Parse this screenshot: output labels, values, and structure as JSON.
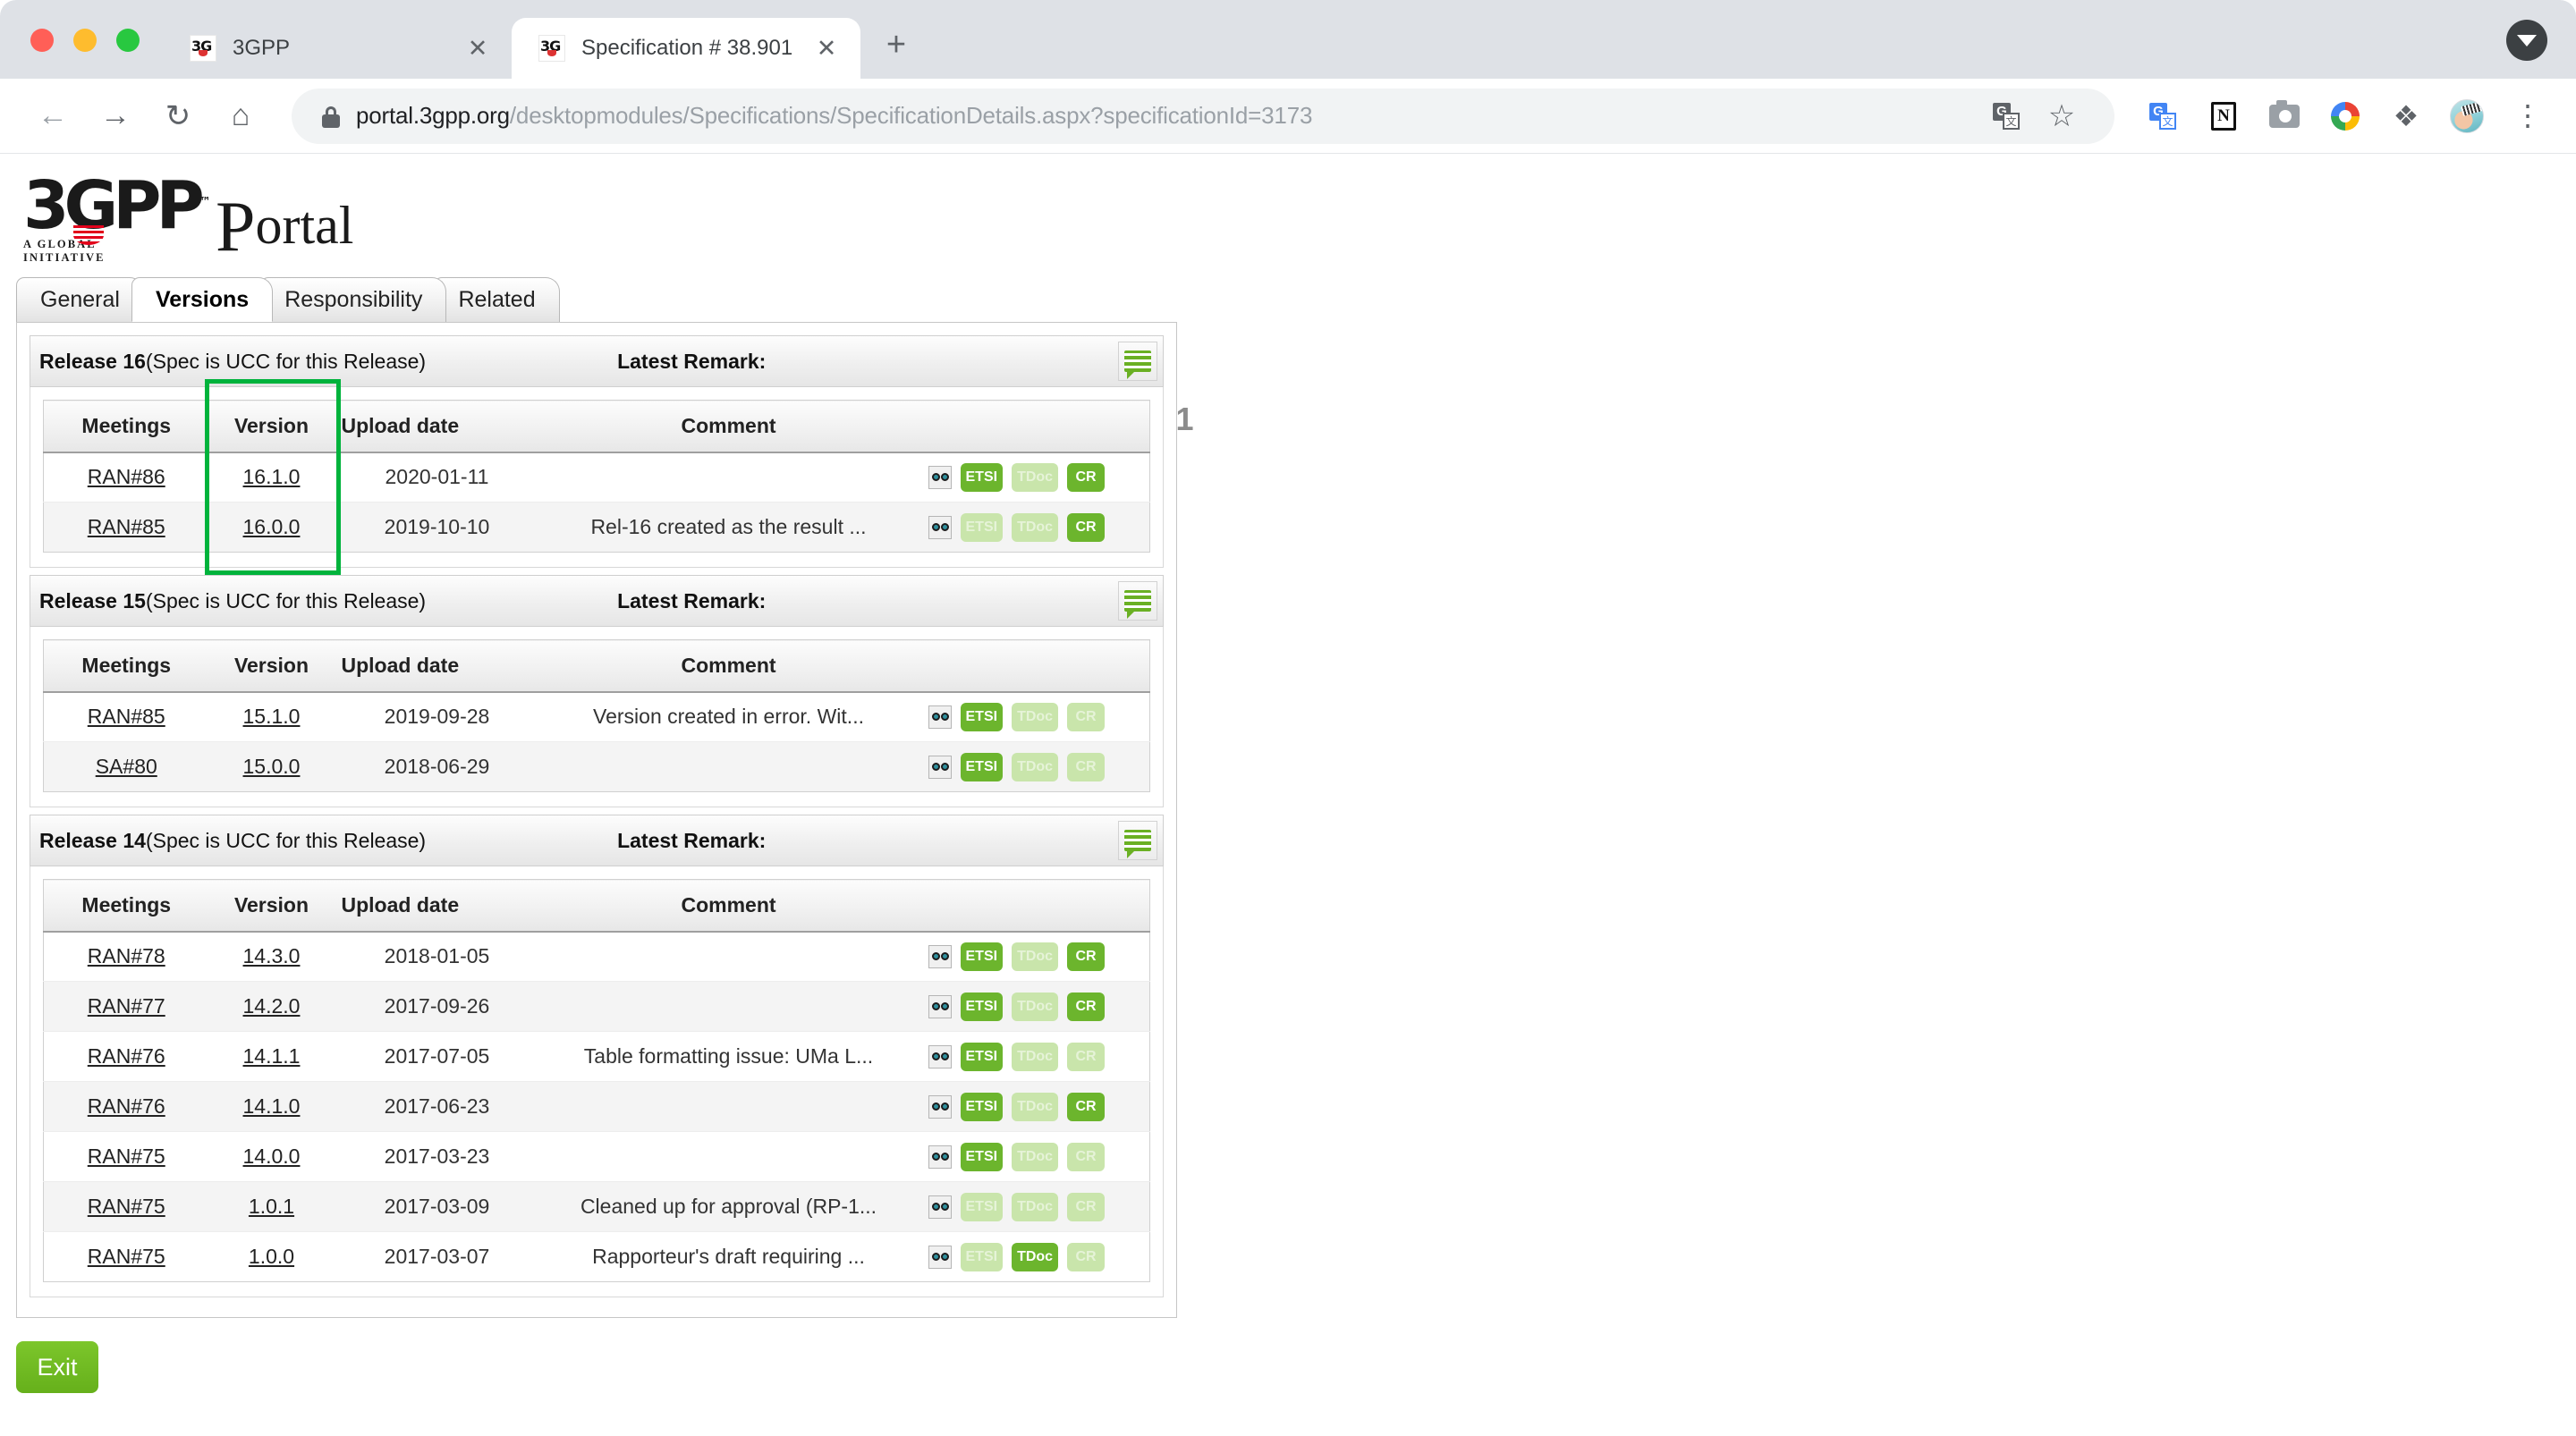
{
  "browser": {
    "tabs": [
      {
        "title": "3GPP",
        "favicon": "3gpp-favicon",
        "active": false,
        "close_label": "✕"
      },
      {
        "title": "Specification # 38.901",
        "favicon": "3gpp-favicon",
        "active": true,
        "close_label": "✕"
      }
    ],
    "new_tab_label": "+",
    "tab_search_icon": "chevron-down-icon",
    "nav": {
      "back_label": "←",
      "forward_label": "→",
      "reload_label": "↻",
      "home_label": "⌂"
    },
    "omnibox": {
      "lock_icon": "lock-icon",
      "url_host": "portal.3gpp.org",
      "url_path": "/desktopmodules/Specifications/SpecificationDetails.aspx?specificationId=3173",
      "translate_icon": "translate-icon",
      "bookmark_icon": "star-icon"
    },
    "extensions": [
      {
        "name": "google-translate-icon"
      },
      {
        "name": "notion-icon",
        "glyph": "N"
      },
      {
        "name": "screenshot-camera-icon"
      },
      {
        "name": "google-photos-icon"
      },
      {
        "name": "extensions-puzzle-icon",
        "glyph": "❖"
      },
      {
        "name": "profile-avatar-icon"
      },
      {
        "name": "chrome-menu-icon",
        "glyph": "⋮"
      }
    ]
  },
  "site": {
    "logo": {
      "mark": "3GPP",
      "tm": "™",
      "tagline": "A GLOBAL INITIATIVE",
      "portal_p": "P",
      "portal_rest": "ortal"
    },
    "tabs": [
      {
        "label": "General",
        "active": false
      },
      {
        "label": "Versions",
        "active": true
      },
      {
        "label": "Responsibility",
        "active": false
      },
      {
        "label": "Related",
        "active": false
      }
    ],
    "spec_title": "Specification #: 38.901",
    "exit_label": "Exit",
    "columns": [
      "Meetings",
      "Version",
      "Upload date",
      "Comment"
    ],
    "remark_label": "Latest Remark:",
    "note_icon": "comment-note-icon",
    "preview_icon": "document-preview-icon",
    "highlight_color": "#00b33c",
    "badge_on_color": "#6cb52d",
    "badge_off_color": "#c9e5ab",
    "releases": [
      {
        "name": "Release 16",
        "ucc_note": "(Spec is UCC for this Release)",
        "remark_value": "",
        "rows": [
          {
            "meeting": "RAN#86",
            "version": "16.1.0",
            "date": "2020-01-11",
            "comment": "",
            "badges": [
              {
                "label": "ETSI",
                "on": true
              },
              {
                "label": "TDoc",
                "on": false
              },
              {
                "label": "CR",
                "on": true
              }
            ]
          },
          {
            "meeting": "RAN#85",
            "version": "16.0.0",
            "date": "2019-10-10",
            "comment": "Rel-16 created as the result ...",
            "badges": [
              {
                "label": "ETSI",
                "on": false
              },
              {
                "label": "TDoc",
                "on": false
              },
              {
                "label": "CR",
                "on": true
              }
            ]
          }
        ]
      },
      {
        "name": "Release 15",
        "ucc_note": "(Spec is UCC for this Release)",
        "remark_value": "",
        "rows": [
          {
            "meeting": "RAN#85",
            "version": "15.1.0",
            "date": "2019-09-28",
            "comment": "Version created in error. Wit...",
            "badges": [
              {
                "label": "ETSI",
                "on": true
              },
              {
                "label": "TDoc",
                "on": false
              },
              {
                "label": "CR",
                "on": false
              }
            ]
          },
          {
            "meeting": "SA#80",
            "version": "15.0.0",
            "date": "2018-06-29",
            "comment": "",
            "badges": [
              {
                "label": "ETSI",
                "on": true
              },
              {
                "label": "TDoc",
                "on": false
              },
              {
                "label": "CR",
                "on": false
              }
            ]
          }
        ]
      },
      {
        "name": "Release 14",
        "ucc_note": "(Spec is UCC for this Release)",
        "remark_value": "",
        "rows": [
          {
            "meeting": "RAN#78",
            "version": "14.3.0",
            "date": "2018-01-05",
            "comment": "",
            "badges": [
              {
                "label": "ETSI",
                "on": true
              },
              {
                "label": "TDoc",
                "on": false
              },
              {
                "label": "CR",
                "on": true
              }
            ]
          },
          {
            "meeting": "RAN#77",
            "version": "14.2.0",
            "date": "2017-09-26",
            "comment": "",
            "badges": [
              {
                "label": "ETSI",
                "on": true
              },
              {
                "label": "TDoc",
                "on": false
              },
              {
                "label": "CR",
                "on": true
              }
            ]
          },
          {
            "meeting": "RAN#76",
            "version": "14.1.1",
            "date": "2017-07-05",
            "comment": "Table formatting issue: UMa L...",
            "badges": [
              {
                "label": "ETSI",
                "on": true
              },
              {
                "label": "TDoc",
                "on": false
              },
              {
                "label": "CR",
                "on": false
              }
            ]
          },
          {
            "meeting": "RAN#76",
            "version": "14.1.0",
            "date": "2017-06-23",
            "comment": "",
            "badges": [
              {
                "label": "ETSI",
                "on": true
              },
              {
                "label": "TDoc",
                "on": false
              },
              {
                "label": "CR",
                "on": true
              }
            ]
          },
          {
            "meeting": "RAN#75",
            "version": "14.0.0",
            "date": "2017-03-23",
            "comment": "",
            "badges": [
              {
                "label": "ETSI",
                "on": true
              },
              {
                "label": "TDoc",
                "on": false
              },
              {
                "label": "CR",
                "on": false
              }
            ]
          },
          {
            "meeting": "RAN#75",
            "version": "1.0.1",
            "date": "2017-03-09",
            "comment": "Cleaned up for approval (RP-1...",
            "badges": [
              {
                "label": "ETSI",
                "on": false
              },
              {
                "label": "TDoc",
                "on": false
              },
              {
                "label": "CR",
                "on": false
              }
            ]
          },
          {
            "meeting": "RAN#75",
            "version": "1.0.0",
            "date": "2017-03-07",
            "comment": "Rapporteur's draft requiring ...",
            "badges": [
              {
                "label": "ETSI",
                "on": false
              },
              {
                "label": "TDoc",
                "on": true
              },
              {
                "label": "CR",
                "on": false
              }
            ]
          }
        ]
      }
    ]
  }
}
